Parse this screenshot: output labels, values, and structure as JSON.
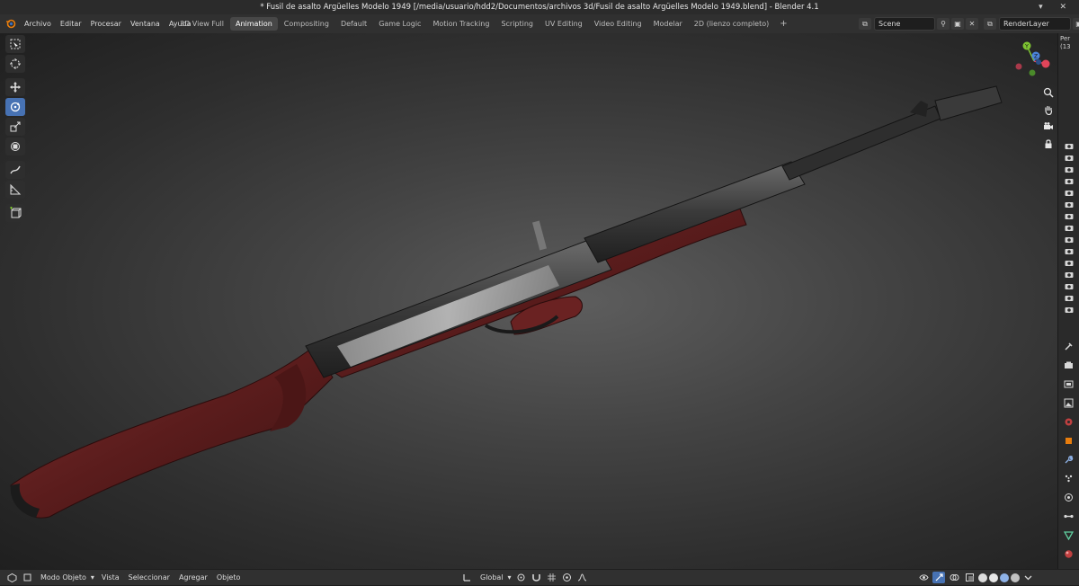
{
  "window": {
    "title": "* Fusil de asalto Argüelles Modelo 1949 [/media/usuario/hdd2/Documentos/archivos 3d/Fusil de asalto Argüelles Modelo 1949.blend] - Blender 4.1"
  },
  "menubar": {
    "items": [
      "Archivo",
      "Editar",
      "Procesar",
      "Ventana",
      "Ayuda"
    ],
    "workspace_tabs": [
      {
        "label": "3D View Full",
        "active": false
      },
      {
        "label": "Animation",
        "active": true
      },
      {
        "label": "Compositing",
        "active": false
      },
      {
        "label": "Default",
        "active": false
      },
      {
        "label": "Game Logic",
        "active": false
      },
      {
        "label": "Motion Tracking",
        "active": false
      },
      {
        "label": "Scripting",
        "active": false
      },
      {
        "label": "UV Editing",
        "active": false
      },
      {
        "label": "Video Editing",
        "active": false
      },
      {
        "label": "Modelar",
        "active": false
      },
      {
        "label": "2D (lienzo completo)",
        "active": false
      }
    ],
    "add_tab": "+",
    "scene": "Scene",
    "view_layer": "RenderLayer"
  },
  "right_strip": {
    "view_label_line1": "Per",
    "view_label_line2": "(13"
  },
  "bottombar": {
    "mode": "Modo Objeto",
    "menus": [
      "Vista",
      "Seleccionar",
      "Agregar",
      "Objeto"
    ],
    "transform_orientation": "Global"
  },
  "icons": {
    "tools": [
      "select-box-icon",
      "cursor-icon",
      "move-icon",
      "rotate-icon",
      "scale-icon",
      "transform-icon",
      "annotate-icon",
      "measure-icon",
      "add-cube-icon"
    ],
    "navigation": [
      "zoom-icon",
      "hand-pan-icon",
      "camera-icon",
      "lock-icon"
    ]
  },
  "colors": {
    "active_tab": "#474747",
    "active_tool": "#4772b3",
    "axis_x": "#e0455a",
    "axis_y": "#7ec432",
    "axis_z": "#4a82d8"
  }
}
